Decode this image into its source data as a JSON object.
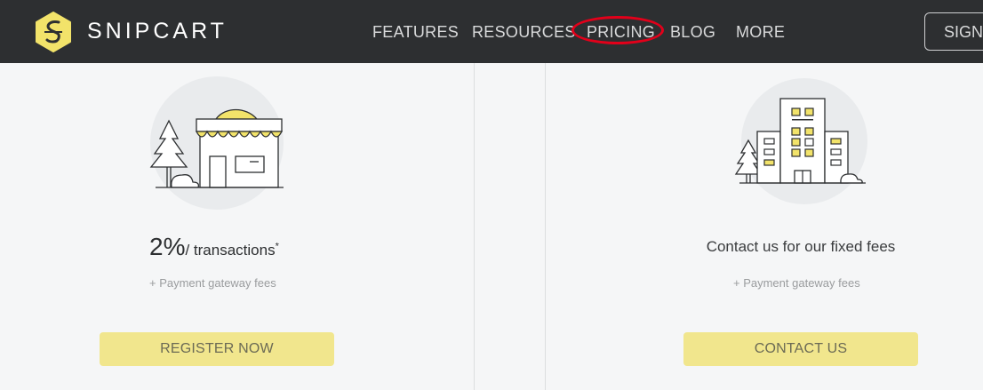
{
  "header": {
    "brand": "SNIPCART",
    "nav": [
      {
        "label": "FEATURES"
      },
      {
        "label": "RESOURCES"
      },
      {
        "label": "PRICING"
      },
      {
        "label": "BLOG"
      },
      {
        "label": "MORE"
      }
    ],
    "sign_label": "SIGN"
  },
  "plans": {
    "standard": {
      "price_value": "2%",
      "price_unit": "/ transactions",
      "price_note": "*",
      "gateway_note": "+ Payment gateway fees",
      "cta_label": "REGISTER NOW"
    },
    "enterprise": {
      "headline": "Contact us for our fixed fees",
      "gateway_note": "+ Payment gateway fees",
      "cta_label": "CONTACT US"
    }
  },
  "colors": {
    "header_bg": "#2d2f31",
    "accent_yellow": "#f1e68d",
    "logo_yellow": "#f2e36a",
    "highlight_ring": "#e2001a"
  },
  "icons": {
    "logo": "snipcart-logo-icon",
    "store": "storefront-illustration",
    "building": "office-building-illustration"
  }
}
